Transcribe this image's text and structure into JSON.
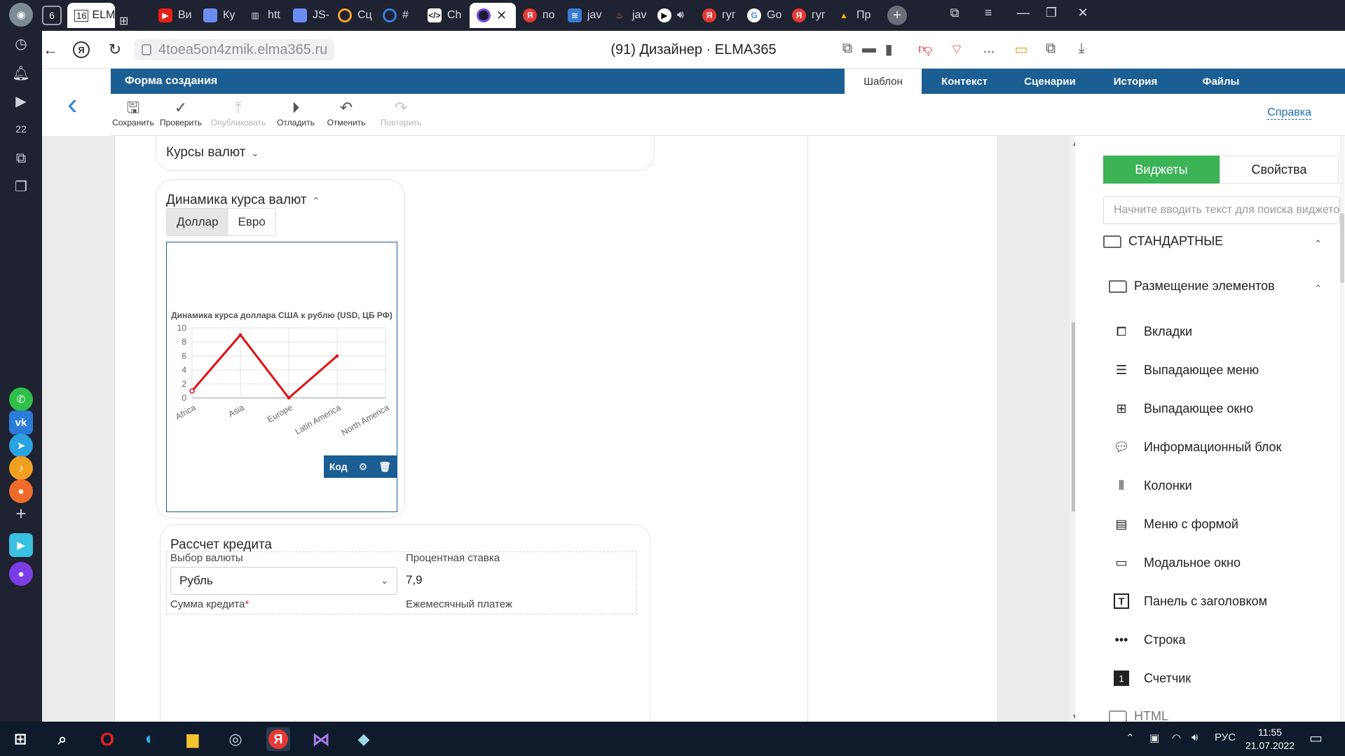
{
  "browser": {
    "tab_counter": "6",
    "tabs": [
      {
        "label": "ELMA",
        "badge": "16",
        "active": false
      },
      {
        "label": "Ви",
        "fav_color": "#e62117"
      },
      {
        "label": "Ку",
        "fav_color": "#6b8cf0"
      },
      {
        "label": "htt",
        "fav_color": "#dddddd"
      },
      {
        "label": "JS-",
        "fav_color": "#6b8cf0"
      },
      {
        "label": "Сц",
        "fav_color": "#f0a030"
      },
      {
        "label": "#",
        "fav_color": "#3a7bd5"
      },
      {
        "label": "Ch",
        "fav_color": "#ffffff"
      },
      {
        "label": "",
        "fav_color": "#7a4de0",
        "active": true
      },
      {
        "label": "по",
        "fav_color": "#e53935"
      },
      {
        "label": "jav",
        "fav_color": "#3a7bd5"
      },
      {
        "label": "jav",
        "fav_color": "#e07b39"
      },
      {
        "label": "",
        "fav_color": "#ffffff"
      },
      {
        "label": "гуг",
        "fav_color": "#e53935"
      },
      {
        "label": "Go",
        "fav_color": "#ffffff"
      },
      {
        "label": "гуг",
        "fav_color": "#e53935"
      },
      {
        "label": "Пр",
        "fav_color": "#f4b400"
      }
    ],
    "url": "4toea5on4zmik.elma365.ru",
    "page_title": "(91) Дизайнер · ELMA365",
    "more": "..."
  },
  "app": {
    "form_title": "Форма создания",
    "top_tabs": [
      "Шаблон",
      "Контекст",
      "Сценарии",
      "История",
      "Файлы"
    ],
    "toolbar": {
      "save": "Сохранить",
      "check": "Проверить",
      "publish": "Опубликовать",
      "debug": "Отладить",
      "undo": "Отменить",
      "redo": "Повторить"
    },
    "help": "Справка"
  },
  "canvas": {
    "panel1_title": "Курсы валют",
    "panel2_title": "Динамика курса валют",
    "seg_tabs": [
      "Доллар",
      "Евро"
    ],
    "widget_actions": {
      "code": "Код"
    },
    "credit": {
      "title": "Рассчет кредита",
      "currency_label": "Выбор валюты",
      "currency_value": "Рубль",
      "rate_label": "Процентная ставка",
      "rate_value": "7,9",
      "sum_label": "Сумма кредита",
      "sum_required": "*",
      "monthly_label": "Ежемесячный платеж"
    }
  },
  "chart_data": {
    "type": "line",
    "title": "Динамика курса доллара США к рублю (USD, ЦБ РФ)",
    "categories": [
      "Africa",
      "Asia",
      "Europe",
      "Latin America",
      "North America"
    ],
    "series": [
      {
        "values": [
          1,
          9,
          0,
          6,
          null
        ],
        "color": "#e01010"
      }
    ],
    "ylim": [
      0,
      10
    ],
    "yticks": [
      0,
      2,
      4,
      6,
      8,
      10
    ],
    "grid": true
  },
  "right_panel": {
    "tab_widgets": "Виджеты",
    "tab_props": "Свойства",
    "search_placeholder": "Начните вводить текст для поиска виджетов",
    "group_standard": "СТАНДАРТНЫЕ",
    "group_layout": "Размещение элементов",
    "items": [
      {
        "label": "Вкладки",
        "icon": "tabs-icon"
      },
      {
        "label": "Выпадающее меню",
        "icon": "dropdown-menu-icon"
      },
      {
        "label": "Выпадающее окно",
        "icon": "dropdown-window-icon"
      },
      {
        "label": "Информационный блок",
        "icon": "info-block-icon"
      },
      {
        "label": "Колонки",
        "icon": "columns-icon"
      },
      {
        "label": "Меню с формой",
        "icon": "menu-form-icon"
      },
      {
        "label": "Модальное окно",
        "icon": "modal-window-icon"
      },
      {
        "label": "Панель с заголовком",
        "icon": "titled-panel-icon"
      },
      {
        "label": "Строка",
        "icon": "row-icon"
      },
      {
        "label": "Счетчик",
        "icon": "counter-icon"
      }
    ],
    "next_group_partial": "HTML"
  },
  "taskbar": {
    "lang": "РУС",
    "time": "11:55",
    "date": "21.07.2022"
  }
}
